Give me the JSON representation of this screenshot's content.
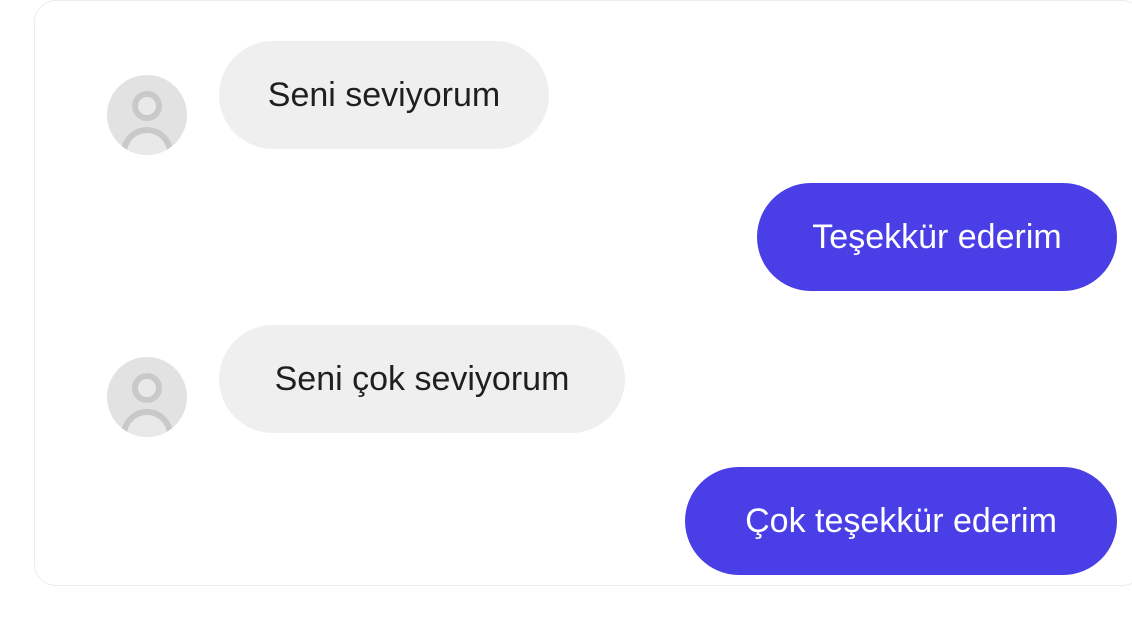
{
  "messages": [
    {
      "direction": "received",
      "text": "Seni seviyorum"
    },
    {
      "direction": "sent",
      "text": "Teşekkür ederim"
    },
    {
      "direction": "received",
      "text": "Seni çok seviyorum"
    },
    {
      "direction": "sent",
      "text": "Çok teşekkür ederim"
    }
  ],
  "colors": {
    "sent_bubble": "#4a3fe6",
    "received_bubble": "#efefef",
    "avatar": "#e2e2e2"
  },
  "icons": {
    "avatar": "user-avatar-icon"
  }
}
